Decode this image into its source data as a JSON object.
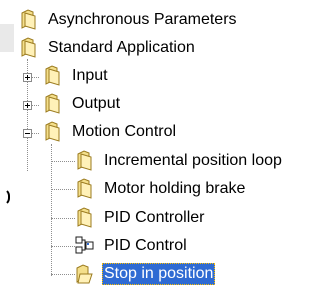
{
  "tree": {
    "nodes": [
      {
        "label": "Asynchronous Parameters"
      },
      {
        "label": "Standard Application"
      },
      {
        "label": "Input"
      },
      {
        "label": "Output"
      },
      {
        "label": "Motion Control"
      },
      {
        "label": "Incremental position loop"
      },
      {
        "label": "Motor holding brake"
      },
      {
        "label": "PID Controller"
      },
      {
        "label": "PID Control"
      },
      {
        "label": "Stop in position"
      }
    ],
    "selected_node": "Stop in position"
  },
  "colors": {
    "selection": "#2f6bd3",
    "focus_outline": "#ffbf00",
    "folder_fill": "#f4df8b",
    "folder_stroke": "#9b7b1f"
  },
  "icons": {
    "folder": "folder-icon",
    "module": "module-icon",
    "expand": "plus-icon",
    "collapse": "minus-icon"
  }
}
